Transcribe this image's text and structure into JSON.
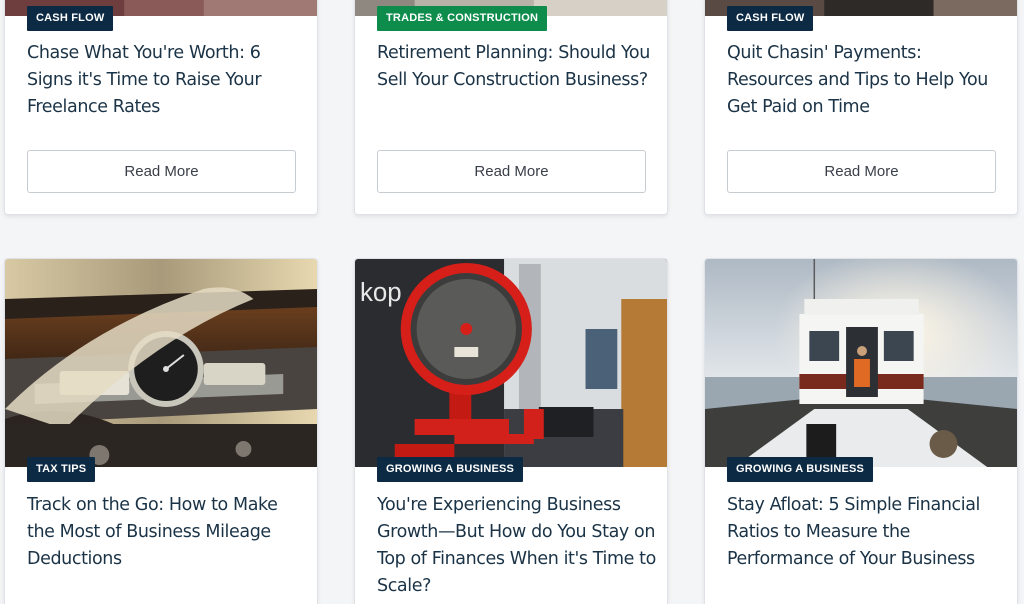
{
  "colors": {
    "navy_badge": "#0c2a43",
    "green_badge": "#0d8c4c",
    "title_text": "#1b3346"
  },
  "row1": [
    {
      "category": "CASH FLOW",
      "title": "Chase What You're Worth: 6 Signs it's Time to Raise Your Freelance Rates",
      "button": "Read More"
    },
    {
      "category": "TRADES & CONSTRUCTION",
      "title": "Retirement Planning: Should You Sell Your Construction Business?",
      "button": "Read More"
    },
    {
      "category": "CASH FLOW",
      "title": "Quit Chasin' Payments: Resources and Tips to Help You Get Paid on Time",
      "button": "Read More"
    }
  ],
  "row2": [
    {
      "category": "TAX TIPS",
      "title": "Track on the Go: How to Make the Most of Business Mileage Deductions",
      "image": "car-dashboard-image"
    },
    {
      "category": "GROWING A BUSINESS",
      "title": "You're Experiencing Business Growth—But How do You Stay on Top of Finances When it's Time to Scale?",
      "image": "red-scale-image"
    },
    {
      "category": "GROWING A BUSINESS",
      "title": "Stay Afloat: 5 Simple Financial Ratios to Measure the Performance of Your Business",
      "image": "boat-deck-image"
    }
  ]
}
